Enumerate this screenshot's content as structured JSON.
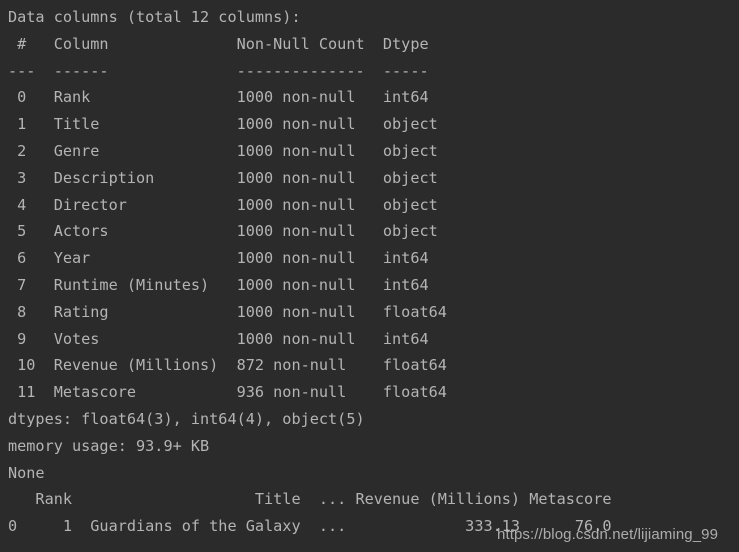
{
  "console": {
    "background_color": "#2b2b2b",
    "text_color": "#b4b4b4",
    "accent_number_color": "#c08a50",
    "lines": [
      "Data columns (total 12 columns):",
      " #   Column              Non-Null Count  Dtype  ",
      "---  ------              --------------  -----  ",
      " 0   Rank                1000 non-null   int64  ",
      " 1   Title               1000 non-null   object ",
      " 2   Genre               1000 non-null   object ",
      " 3   Description         1000 non-null   object ",
      " 4   Director            1000 non-null   object ",
      " 5   Actors              1000 non-null   object ",
      " 6   Year                1000 non-null   int64  ",
      " 7   Runtime (Minutes)   1000 non-null   int64  ",
      " 8   Rating              1000 non-null   float64",
      " 9   Votes               1000 non-null   int64  ",
      " 10  Revenue (Millions)  872 non-null    float64",
      " 11  Metascore           936 non-null    float64",
      "dtypes: float64(3), int64(4), object(5)",
      "memory usage: 93.9+ KB",
      "None",
      "   Rank                    Title  ... Revenue (Millions) Metascore",
      "0     1  Guardians of the Galaxy  ...             333.13      76.0"
    ],
    "info_header": {
      "title": "Data columns (total 12 columns):",
      "columns": [
        "#",
        "Column",
        "Non-Null Count",
        "Dtype"
      ],
      "separator": [
        "---",
        "------",
        "--------------",
        "-----"
      ]
    },
    "info_rows": [
      {
        "index": "0",
        "column": "Rank",
        "non_null": "1000 non-null",
        "dtype": "int64"
      },
      {
        "index": "1",
        "column": "Title",
        "non_null": "1000 non-null",
        "dtype": "object"
      },
      {
        "index": "2",
        "column": "Genre",
        "non_null": "1000 non-null",
        "dtype": "object"
      },
      {
        "index": "3",
        "column": "Description",
        "non_null": "1000 non-null",
        "dtype": "object"
      },
      {
        "index": "4",
        "column": "Director",
        "non_null": "1000 non-null",
        "dtype": "object"
      },
      {
        "index": "5",
        "column": "Actors",
        "non_null": "1000 non-null",
        "dtype": "object"
      },
      {
        "index": "6",
        "column": "Year",
        "non_null": "1000 non-null",
        "dtype": "int64"
      },
      {
        "index": "7",
        "column": "Runtime (Minutes)",
        "non_null": "1000 non-null",
        "dtype": "int64"
      },
      {
        "index": "8",
        "column": "Rating",
        "non_null": "1000 non-null",
        "dtype": "float64"
      },
      {
        "index": "9",
        "column": "Votes",
        "non_null": "1000 non-null",
        "dtype": "int64"
      },
      {
        "index": "10",
        "column": "Revenue (Millions)",
        "non_null": "872 non-null",
        "dtype": "float64"
      },
      {
        "index": "11",
        "column": "Metascore",
        "non_null": "936 non-null",
        "dtype": "float64"
      }
    ],
    "summary": {
      "dtypes": "dtypes: float64(3), int64(4), object(5)",
      "memory_usage": "memory usage: 93.9+ KB",
      "return_value": "None"
    },
    "dataframe_preview": {
      "header": "   Rank                    Title  ... Revenue (Millions) Metascore",
      "header_cells": [
        "Rank",
        "Title",
        "...",
        "Revenue (Millions)",
        "Metascore"
      ],
      "rows": [
        {
          "index": "0",
          "rank": "1",
          "title": "Guardians of the Galaxy",
          "ellipsis": "...",
          "revenue_millions": "333.13",
          "metascore": "76.0",
          "raw": "0     1  Guardians of the Galaxy  ...             333.13      76.0"
        }
      ]
    }
  },
  "watermark": {
    "text": "https://blog.csdn.net/lijiaming_99"
  }
}
